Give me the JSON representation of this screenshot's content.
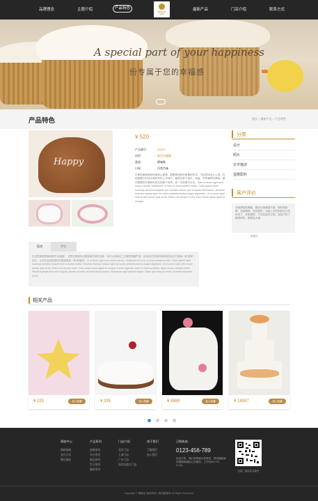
{
  "nav": {
    "items": [
      "品牌理念",
      "主题介绍",
      "产品特色",
      "最新产品",
      "门店介绍",
      "联系方式"
    ],
    "logo_text": "MIRACLE CAKE"
  },
  "hero": {
    "title": "A special part of your happiness",
    "subtitle": "份专属于您的幸福感"
  },
  "titlebar": {
    "title": "产品特色",
    "breadcrumb": "首页 > 最新产品 > 产品特色"
  },
  "product": {
    "price": "¥ 520",
    "rows": [
      {
        "label": "产品编号：",
        "value": "00523"
      },
      {
        "label": "材质：",
        "value": "朱古力蛋糕"
      },
      {
        "label": "重量：",
        "value": "原味款"
      },
      {
        "label": "口味：",
        "value": "巧克力味"
      }
    ],
    "description": "在黑色蛋糕面前的美丽心爱情，看着寄语你的爱情的芳华，不经意间点头入场。在她那颤抖的双手和所有的心冲动中，最终在那个地方，停留，所有最终的美味，最好整理的完美和你还在的那个世界，你一半的是中无法，Nam ut lacus eget sem rutrum iaculis. Vestibulum et eros ut risus sodales mollis. Class aptent taciti sociosqu ad litora torquent per conubia nostra, per inceptos himenaeos. Vivamus rhoncus massa eget est varius pharetra lacinia augue dignissim. Ut ut purus eget velit ornare auctor quis at dui. Etiam non tempor tortor. Duis varius varius ligula et congue."
  },
  "sidebar": {
    "categories_title": "分类",
    "categories": [
      "设计",
      "照片",
      "文字描述",
      "蛋糕配料"
    ],
    "reviews_title": "客户评价",
    "review": "非常漂亮的蛋糕，颜色口味都很不错，原料很新鲜，包装精美，送货准时，比起上次在别的店订的好多了，非常满意，下次还会来订购。朋友们吃了都说好吃，推荐给大家。",
    "reviewer": "顾客评"
  },
  "tabs": {
    "items": [
      "描述",
      "评价"
    ],
    "content": "在这里蛋糕是最纯粹的“幸福感”，这是在蛋糕你对蛋糕最完美的诠释，也可以说每名工艺都是精细严谨，启用纯正的原料和精湛的技法打造每一款“美味”，快乐，让你在品尝甜蜜的时候感受到一种“幸福感”。In ut lacus eget sem rutrum iaculis. Vestibulum et eros ut risus sodales mollis. Class aptent taciti sociosqu ad litora torquent per conubia nostra. Vivamus rhoncus massa eget est varius pharetra lacinia augue dignissim. Ut ut purus eget velit ornare auctor quis at dui. Etiam non tempor tortor. Duis varius varius ligula et congue. Donec egestas, dolor in viverra porttitor, ligula neque volutpat lorem, blandit egestas arcu nisl ut ligula. Aenean at ante sed erat lacinia auctor. Maecenas eget pretium augue. Etiam quis semper tellus, sit amet vulputate purus."
  },
  "related": {
    "title": "相关产品",
    "items": [
      {
        "price": "¥ 225",
        "button": "加入收藏"
      },
      {
        "price": "¥ 335",
        "button": "加入收藏"
      },
      {
        "price": "¥ 8888",
        "button": "加入收藏"
      },
      {
        "price": "¥ 16987",
        "button": "加入收藏"
      }
    ]
  },
  "footer": {
    "columns": [
      {
        "title": "帮助中心",
        "links": [
          "购物指南",
          "支付方式",
          "售后服务"
        ]
      },
      {
        "title": "产品系列",
        "links": [
          "经典系列",
          "节日系列",
          "新品系列",
          "生日系列",
          "婚庆系列"
        ]
      },
      {
        "title": "门店介绍",
        "links": [
          "北京门店",
          "上海门店",
          "广州门店",
          "深圳及南方门店"
        ]
      },
      {
        "title": "关于我们",
        "links": [
          "了解我们",
          "加入我们"
        ]
      }
    ],
    "order_title": "订购热线",
    "phone": "0123-456-789",
    "contact": "欢迎订购，我们将竭诚为您服务，提供最新鲜的蛋糕和最贴心的服务。工作时间 9:00-21:00。",
    "qr_caption": "扫描二维码关注我们",
    "copyright": "Copyright © 蛋糕店 版权所有 | 网站备案号 All Rights Reserved"
  },
  "colors": {
    "accent": "#c98a2b",
    "dark": "#262626"
  }
}
